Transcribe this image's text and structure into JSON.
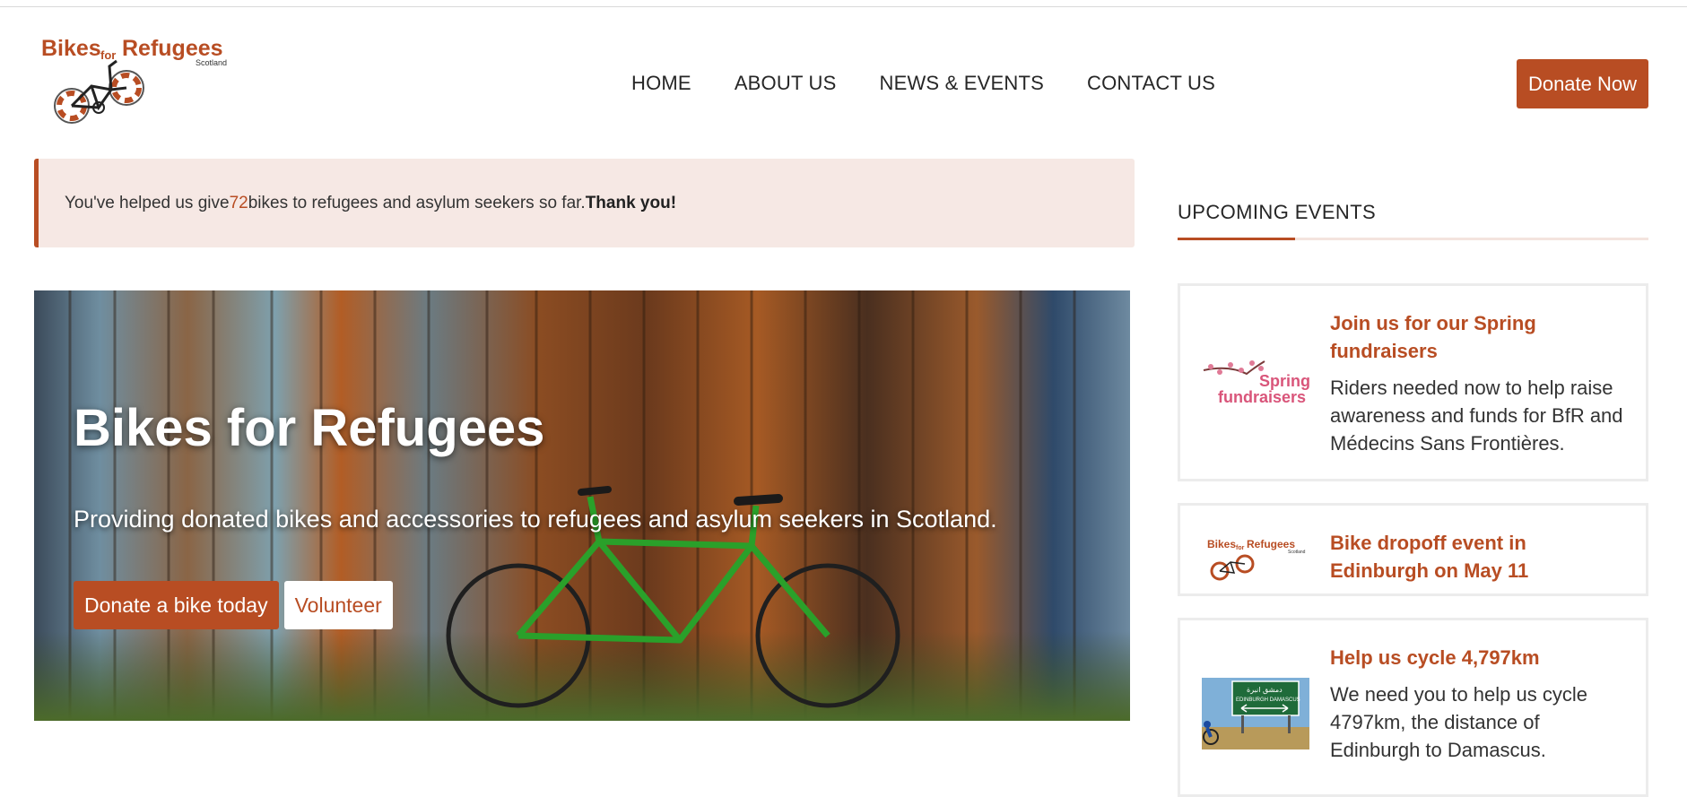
{
  "header": {
    "logo_text": "Bikes for Refugees Scotland",
    "nav": [
      "HOME",
      "ABOUT US",
      "NEWS & EVENTS",
      "CONTACT US"
    ],
    "donate_label": "Donate Now"
  },
  "notice": {
    "prefix": "You've helped us give ",
    "count": "72",
    "suffix": " bikes to refugees and asylum seekers so far. ",
    "thanks": "Thank you!"
  },
  "hero": {
    "title": "Bikes for Refugees",
    "subtitle": "Providing donated bikes and accessories to refugees and asylum seekers in Scotland.",
    "primary_button": "Donate a bike today",
    "secondary_button": "Volunteer"
  },
  "sidebar": {
    "heading": "UPCOMING EVENTS",
    "events": [
      {
        "title": "Join us for our Spring fundraisers",
        "description": "Riders needed now to help raise awareness and funds for BfR and Médecins Sans Frontières.",
        "thumb_text": "Spring fundraisers"
      },
      {
        "title": "Bike dropoff event in Edinburgh on May 11",
        "description": "",
        "thumb_text": "Bikes for Refugees Scotland"
      },
      {
        "title": "Help us cycle 4,797km",
        "description": "We need you to help us cycle 4797km, the distance of Edinburgh to Damascus.",
        "thumb_text": "دمشق انبرة EDINBURGH DAMASCUS"
      }
    ]
  },
  "colors": {
    "accent": "#b84d23",
    "notice_bg": "#f6e8e4"
  }
}
